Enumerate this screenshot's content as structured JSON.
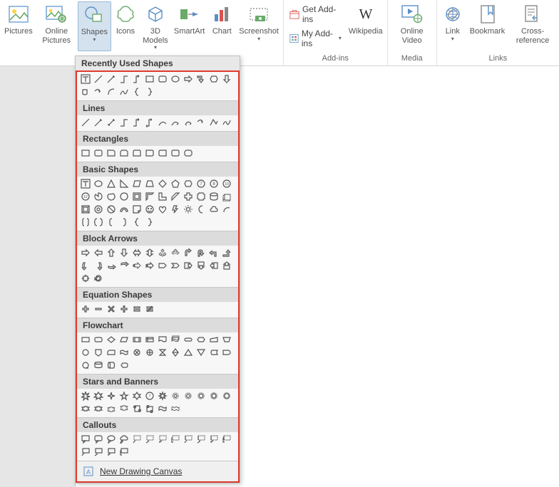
{
  "ribbon": {
    "illustrations": {
      "pictures": "Pictures",
      "online_pictures": "Online Pictures",
      "shapes": "Shapes",
      "icons": "Icons",
      "models": "3D Models",
      "smartart": "SmartArt",
      "chart": "Chart",
      "screenshot": "Screenshot"
    },
    "addins": {
      "get": "Get Add-ins",
      "my": "My Add-ins",
      "wikipedia": "Wikipedia",
      "caption": "Add-ins"
    },
    "media": {
      "online_video": "Online Video",
      "caption": "Media"
    },
    "links": {
      "link": "Link",
      "bookmark": "Bookmark",
      "cross": "Cross-reference",
      "caption": "Links"
    }
  },
  "shapes_menu": {
    "recently_used": "Recently Used Shapes",
    "lines": "Lines",
    "rectangles": "Rectangles",
    "basic": "Basic Shapes",
    "block_arrows": "Block Arrows",
    "equation": "Equation Shapes",
    "flowchart": "Flowchart",
    "stars": "Stars and Banners",
    "callouts": "Callouts",
    "new_canvas": "New Drawing Canvas"
  }
}
